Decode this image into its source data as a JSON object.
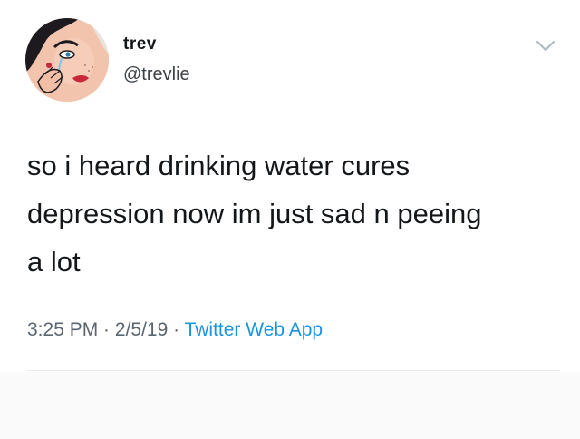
{
  "author": {
    "display_name": "trev",
    "handle": "@trevlie"
  },
  "icons": {
    "menu": "chevron-down-icon"
  },
  "tweet": {
    "lines": [
      "so i heard drinking water cures",
      "depression now im just sad n peeing",
      "a lot"
    ]
  },
  "meta": {
    "time": "3:25 PM",
    "separator1": " · ",
    "date": "2/5/19",
    "separator2": " · ",
    "app": "Twitter Web App"
  },
  "colors": {
    "link": "#1b95e0",
    "secondary_text": "#5b6570",
    "chevron": "#aab8c2"
  }
}
